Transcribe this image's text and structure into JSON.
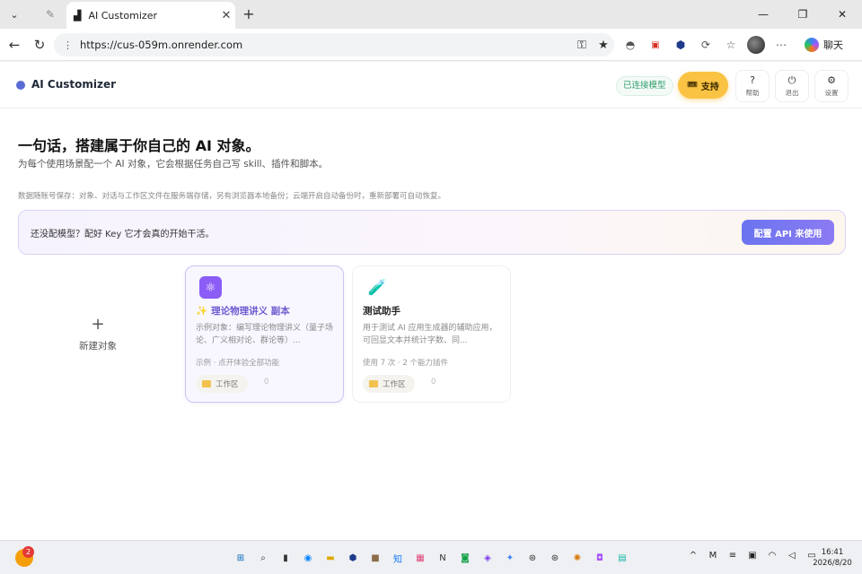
{
  "browser": {
    "tab_menu_icon": "chevron-down-icon",
    "inactive_tab_icon": "pin-icon",
    "active_tab": {
      "title": "AI Customizer",
      "close": "✕"
    },
    "new_tab": "+",
    "window": {
      "minimize": "—",
      "restore": "❐",
      "close": "✕"
    },
    "url": "https://cus-059m.onrender.com",
    "copilot_label": "聊天"
  },
  "app": {
    "brand_name": "AI Customizer",
    "model_badge": "已连接模型",
    "support_label": "支持",
    "support_icon": "🎟",
    "help": {
      "icon": "?",
      "label": "帮助"
    },
    "logout": {
      "icon": "⏻",
      "label": "退出"
    },
    "settings": {
      "icon": "⚙",
      "label": "设置"
    },
    "accent_color": "#5b6bd6",
    "support_color": "#fbc343"
  },
  "hero": {
    "headline": "一句话，搭建属于你自己的 AI 对象。",
    "subline": "为每个使用场景配一个 AI 对象，它会根据任务自己写 skill、插件和脚本。",
    "note": "数据随账号保存：对象、对话与工作区文件在服务端存储，另有浏览器本地备份；云端开启自动备份时，重新部署可自动恢复。"
  },
  "banner": {
    "text": "还没配模型？配好 Key 它才会真的开始干活。",
    "button": "配置 API 来使用"
  },
  "new_object": {
    "plus": "+",
    "label": "新建对象"
  },
  "cards": [
    {
      "icon": "atom-icon",
      "title_prefix": "✨",
      "title": "理论物理讲义 副本",
      "desc": "示例对象：编写理论物理讲义（量子场论、广义相对论、群论等）...",
      "meta": "示例 · 点开体验全部功能",
      "chip": "工作区",
      "count": "0"
    },
    {
      "icon": "test-tube-icon",
      "title": "测试助手",
      "desc": "用于测试 AI 应用生成器的辅助应用，可回显文本并统计字数、同...",
      "meta": "使用 7 次 · 2 个能力插件",
      "chip": "工作区",
      "count": "0"
    }
  ],
  "taskbar": {
    "notification_count": "2",
    "time": "16:41",
    "date": "2026/8/20"
  }
}
